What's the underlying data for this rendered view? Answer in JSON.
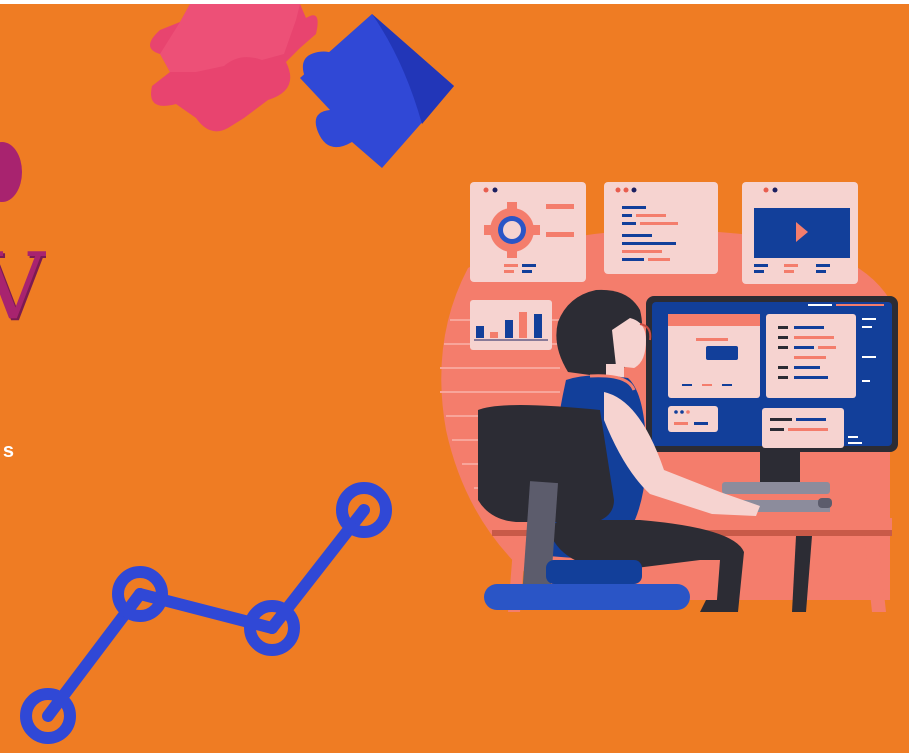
{
  "partial_text": {
    "title_fragment": "V",
    "subtitle_fragment": "s"
  },
  "colors": {
    "background": "#ef7c23",
    "puzzle_pink": "#e8446f",
    "puzzle_blue": "#3048d6",
    "accent_magenta": "#a8236f",
    "monitor_blue": "#123f9a",
    "panel_pink": "#f6d3d0",
    "coral": "#f47d6c"
  },
  "icons": [
    "puzzle-piece",
    "gear",
    "play",
    "bar-chart",
    "line-graph"
  ]
}
